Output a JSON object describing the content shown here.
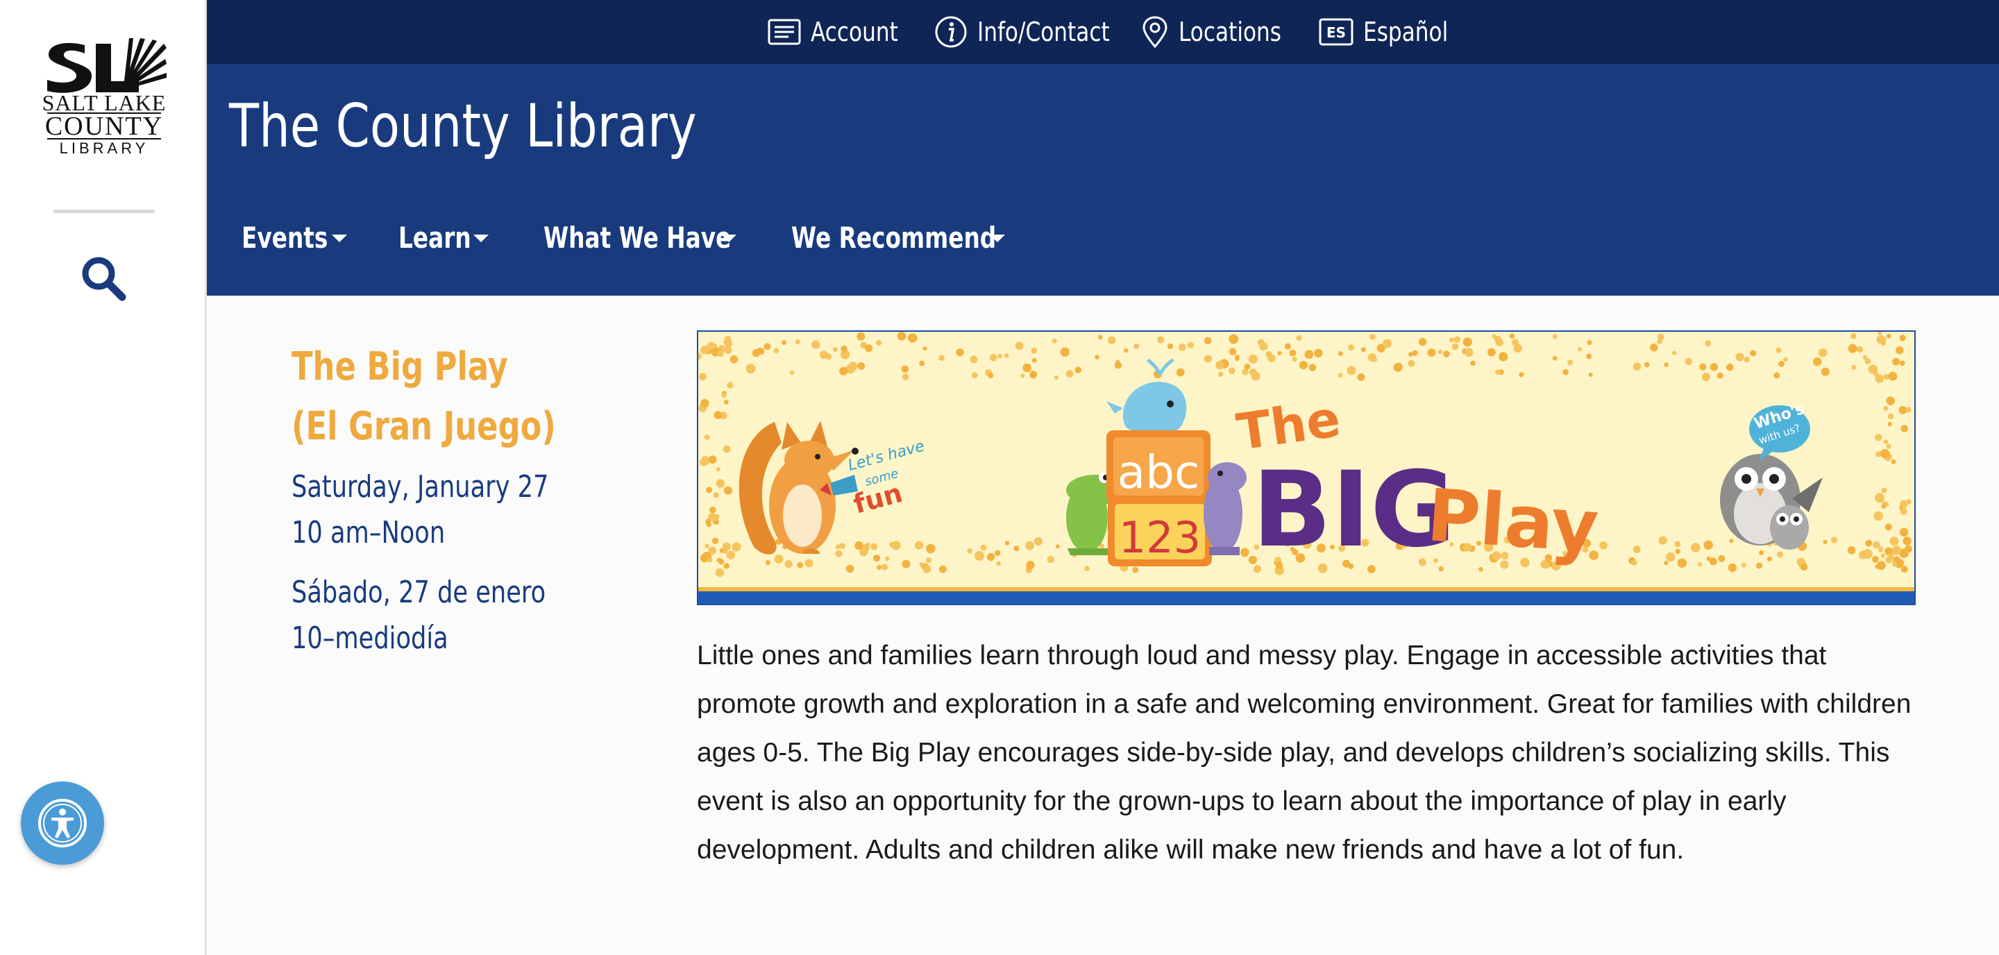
{
  "logo": {
    "line1": "SALT LAKE",
    "line2": "COUNTY",
    "line3": "LIBRARY"
  },
  "sidebar": {
    "search_icon": "search-icon",
    "accessibility_icon": "accessibility-icon"
  },
  "utility_nav": {
    "items": [
      {
        "label": "Account",
        "icon": "account-card-icon"
      },
      {
        "label": "Info/Contact",
        "icon": "info-icon"
      },
      {
        "label": "Locations",
        "icon": "map-pin-icon"
      },
      {
        "label": "Español",
        "icon": "es-language-icon",
        "badge": "ES"
      }
    ]
  },
  "header": {
    "title": "The County Library"
  },
  "main_nav": {
    "items": [
      {
        "label": "Events"
      },
      {
        "label": "Learn"
      },
      {
        "label": "What We Have"
      },
      {
        "label": "We Recommend"
      }
    ]
  },
  "event": {
    "title_line1": "The Big Play",
    "title_line2": "(El Gran Juego)",
    "date_en": "Saturday, January 27",
    "time_en": "10 am–Noon",
    "date_es": "Sábado, 27 de enero",
    "time_es": "10–mediodía"
  },
  "banner": {
    "title_the": "The",
    "title_big": "BIG",
    "title_play": "Play",
    "block_top": "abc",
    "block_bottom": "123",
    "fox_bubble_1": "Let's have",
    "fox_bubble_2": "some",
    "fox_bubble_3": "fun",
    "owl_bubble_1": "Who's",
    "owl_bubble_2": "with us?"
  },
  "description": "Little ones and families learn through loud and messy play. Engage in accessible activities that promote growth and exploration in a safe and welcoming environment. Great for families with children ages 0-5. The Big Play encourages side-by-side play, and develops children’s socializing skills. This event is also an opportunity for the grown-ups to learn about the importance of play in early development. Adults and children alike will make new friends and have a lot of fun.",
  "colors": {
    "utility_bar": "#0f2556",
    "header": "#193b7e",
    "event_title": "#efa93d",
    "event_text": "#193b7e",
    "accessibility_button": "#4a9bd6"
  }
}
